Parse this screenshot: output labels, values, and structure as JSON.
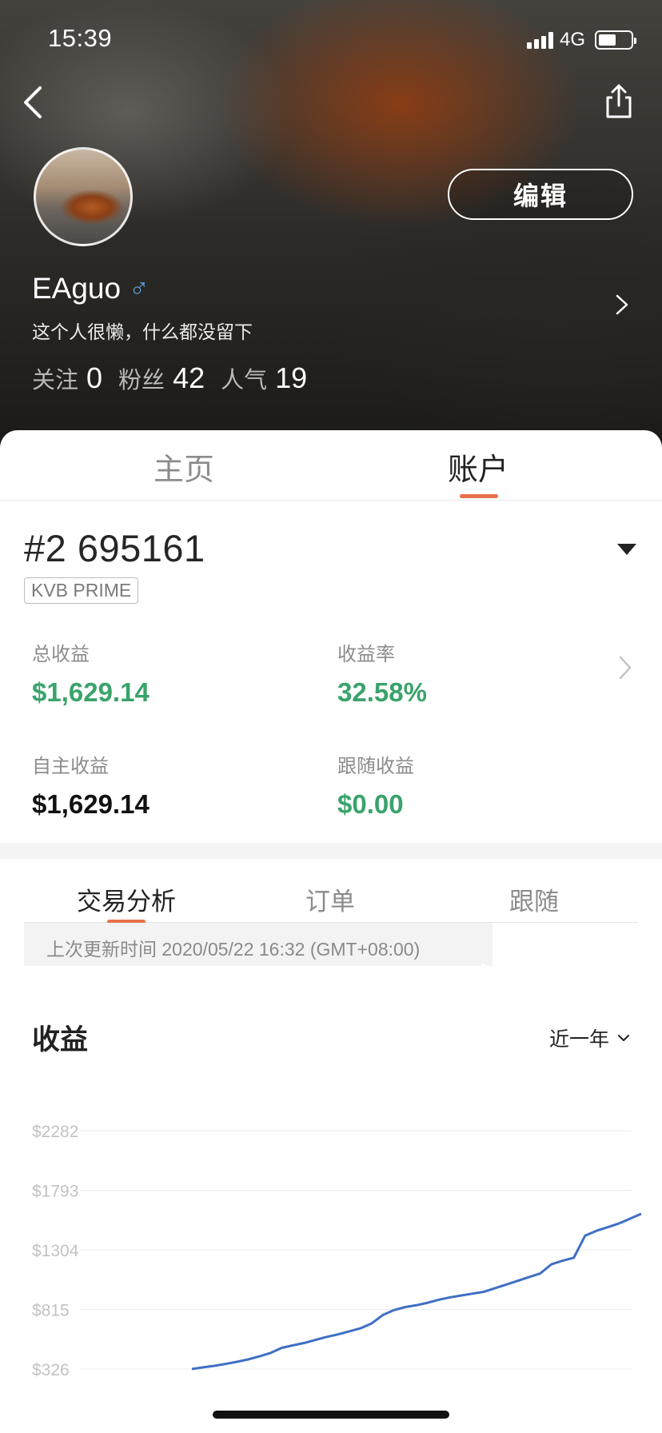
{
  "status_bar": {
    "time": "15:39",
    "network": "4G"
  },
  "profile": {
    "name": "EAguo",
    "gender_symbol": "♂",
    "bio": "这个人很懒，什么都没留下",
    "edit_label": "编辑",
    "stats": [
      {
        "label": "关注",
        "value": "0"
      },
      {
        "label": "粉丝",
        "value": "42"
      },
      {
        "label": "人气",
        "value": "19"
      }
    ]
  },
  "main_tabs": [
    {
      "label": "主页",
      "active": false
    },
    {
      "label": "账户",
      "active": true
    }
  ],
  "account": {
    "number": "#2 695161",
    "server": "KVB PRIME",
    "metrics": [
      {
        "label": "总收益",
        "value": "$1,629.14",
        "color": "#3aa36b"
      },
      {
        "label": "收益率",
        "value": "32.58%",
        "color": "#3aa36b"
      },
      {
        "label": "自主收益",
        "value": "$1,629.14",
        "color": "#111111"
      },
      {
        "label": "跟随收益",
        "value": "$0.00",
        "color": "#3aa36b"
      }
    ]
  },
  "sub_tabs": [
    {
      "label": "交易分析",
      "active": true
    },
    {
      "label": "订单",
      "active": false
    },
    {
      "label": "跟随",
      "active": false
    }
  ],
  "last_update": "上次更新时间 2020/05/22 16:32 (GMT+08:00)",
  "chart_section": {
    "title": "收益",
    "range_label": "近一年"
  },
  "chart_data": {
    "type": "line",
    "title": "收益",
    "y_tick_labels": [
      "$2282",
      "$1793",
      "$1304",
      "$815",
      "$326"
    ],
    "y_ticks": [
      2282,
      1793,
      1304,
      815,
      326
    ],
    "ylim": [
      326,
      2282
    ],
    "grid": true,
    "series": [
      {
        "color": "#3f6fc4",
        "values": [
          326,
          340,
          352,
          368,
          385,
          405,
          430,
          458,
          500,
          520,
          540,
          565,
          590,
          610,
          635,
          660,
          700,
          770,
          810,
          835,
          850,
          870,
          895,
          915,
          930,
          945,
          960,
          990,
          1020,
          1050,
          1080,
          1110,
          1185,
          1215,
          1240,
          1420,
          1460,
          1490,
          1520,
          1560,
          1600
        ]
      }
    ]
  },
  "colors": {
    "accent": "#e8704a",
    "positive": "#3aa36b",
    "line": "#3f6fc4"
  }
}
